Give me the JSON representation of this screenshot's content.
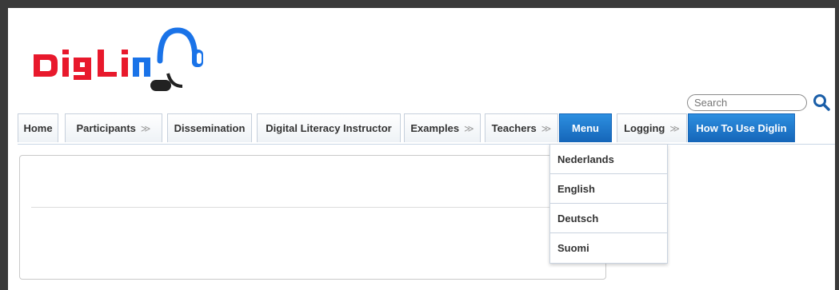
{
  "logo": {
    "text": "DigLin"
  },
  "search": {
    "placeholder": "Search"
  },
  "nav": {
    "tabs": [
      {
        "label": "Home",
        "has_dropdown": false,
        "active": false
      },
      {
        "label": "Participants",
        "has_dropdown": true,
        "active": false
      },
      {
        "label": "Dissemination",
        "has_dropdown": false,
        "active": false
      },
      {
        "label": "Digital Literacy Instructor",
        "has_dropdown": false,
        "active": false
      },
      {
        "label": "Examples",
        "has_dropdown": true,
        "active": false
      },
      {
        "label": "Teachers",
        "has_dropdown": true,
        "active": false
      },
      {
        "label": "Menu",
        "has_dropdown": false,
        "active": true
      },
      {
        "label": "Logging",
        "has_dropdown": true,
        "active": false
      },
      {
        "label": "How To Use Diglin",
        "has_dropdown": false,
        "active": true
      }
    ],
    "dropdown_glyph": "≫"
  },
  "dropdown": {
    "items": [
      {
        "label": "Nederlands"
      },
      {
        "label": "English"
      },
      {
        "label": "Deutsch"
      },
      {
        "label": "Suomi"
      }
    ]
  },
  "colors": {
    "accent": "#1565b8",
    "logo_red": "#e8192c",
    "logo_blue": "#1a73e8"
  }
}
